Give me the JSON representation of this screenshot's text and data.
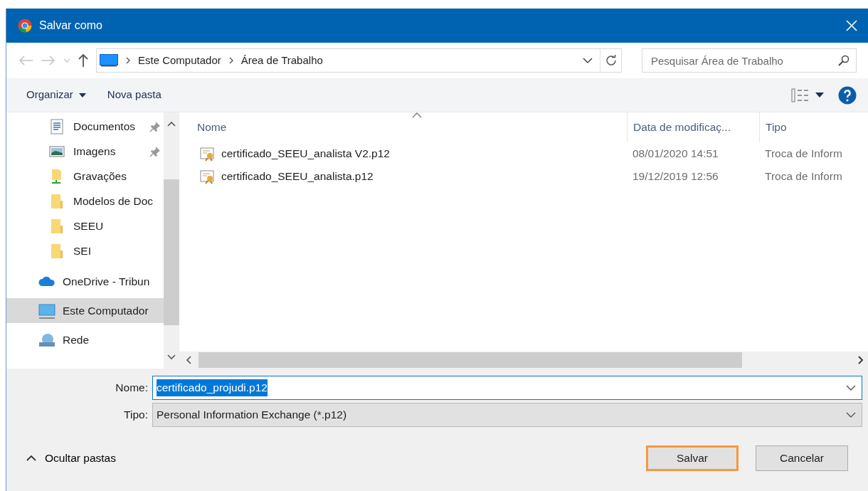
{
  "window": {
    "title": "Salvar como"
  },
  "address_bar": {
    "crumbs": [
      "Este Computador",
      "Área de Trabalho"
    ]
  },
  "search": {
    "placeholder": "Pesquisar Área de Trabalho"
  },
  "toolbar": {
    "buttons": [
      {
        "label": "Organizar",
        "dropdown": true
      },
      {
        "label": "Nova pasta",
        "dropdown": false
      }
    ]
  },
  "sidebar": {
    "sections": [
      {
        "kind": "quick-access",
        "items": [
          {
            "label": "Documentos",
            "kind": "documents",
            "pinned": true,
            "selected": false
          },
          {
            "label": "Imagens",
            "kind": "images",
            "pinned": true,
            "selected": false
          },
          {
            "label": "Gravações",
            "kind": "recordings",
            "pinned": false,
            "selected": false
          },
          {
            "label": "Modelos de Doc",
            "kind": "folder",
            "pinned": false,
            "selected": false
          },
          {
            "label": "SEEU",
            "kind": "folder",
            "pinned": false,
            "selected": false
          },
          {
            "label": "SEI",
            "kind": "folder",
            "pinned": false,
            "selected": false
          }
        ]
      },
      {
        "kind": "root",
        "items": [
          {
            "label": "OneDrive - Tribun",
            "kind": "cloud",
            "pinned": false,
            "selected": false
          }
        ]
      },
      {
        "kind": "root",
        "items": [
          {
            "label": "Este Computador",
            "kind": "computer",
            "pinned": false,
            "selected": true
          }
        ]
      },
      {
        "kind": "root",
        "items": [
          {
            "label": "Rede",
            "kind": "network",
            "pinned": false,
            "selected": false
          }
        ]
      }
    ]
  },
  "file_list": {
    "columns": [
      "Nome",
      "Data de modificaç...",
      "Tipo"
    ],
    "rows": [
      {
        "name": "certificado_SEEU_analista V2.p12",
        "date": "08/01/2020 14:51",
        "type": "Troca de Inform"
      },
      {
        "name": "certificado_SEEU_analista.p12",
        "date": "19/12/2019 12:56",
        "type": "Troca de Inform"
      }
    ]
  },
  "form": {
    "filename": {
      "label": "Nome:",
      "value": "certificado_projudi.p12",
      "text_selected": true
    },
    "file_type": {
      "label": "Tipo:",
      "value": "Personal Information Exchange (*.p12)"
    }
  },
  "footer": {
    "toggle": "Ocultar pastas",
    "buttons": [
      {
        "label": "Salvar",
        "focused": true
      },
      {
        "label": "Cancelar",
        "focused": false
      }
    ]
  }
}
